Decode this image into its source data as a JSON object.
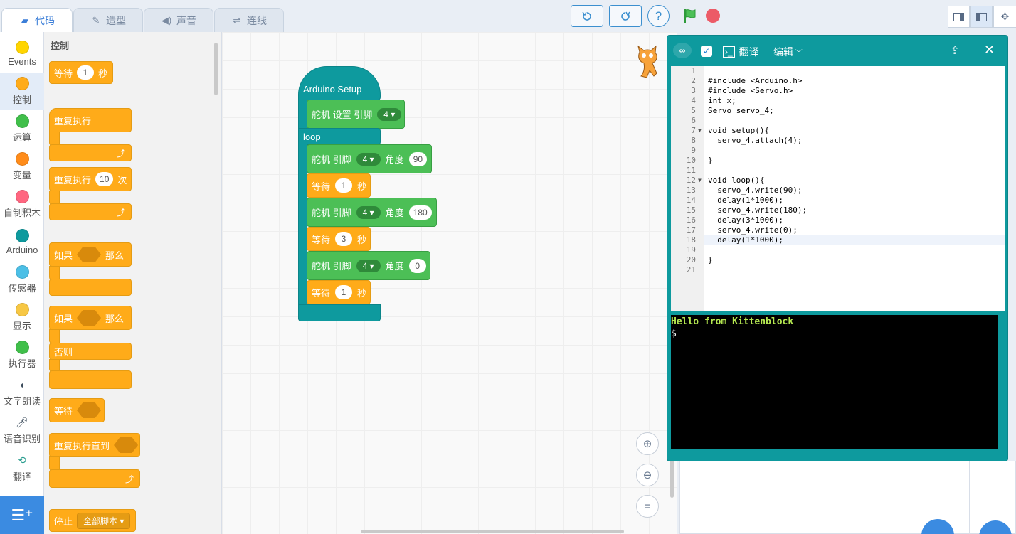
{
  "tabs": [
    {
      "label": "代码",
      "icon": "code-blocks-icon"
    },
    {
      "label": "造型",
      "icon": "brush-icon"
    },
    {
      "label": "声音",
      "icon": "speaker-icon"
    },
    {
      "label": "连线",
      "icon": "wiring-icon"
    }
  ],
  "toolbar": {
    "undo_icon": "undo-icon",
    "redo_icon": "redo-icon",
    "help_label": "?"
  },
  "categories": [
    {
      "label": "Events",
      "color": "#ffd500"
    },
    {
      "label": "控制",
      "color": "#ffab19"
    },
    {
      "label": "运算",
      "color": "#40bf4a"
    },
    {
      "label": "变量",
      "color": "#ff8c1a"
    },
    {
      "label": "自制积木",
      "color": "#ff6680"
    },
    {
      "label": "Arduino",
      "color": "#0e9a9e"
    },
    {
      "label": "传感器",
      "color": "#4cbfe6"
    },
    {
      "label": "显示",
      "color": "#f7c744"
    },
    {
      "label": "执行器",
      "color": "#40bf4a"
    },
    {
      "label": "文字朗读",
      "icon": "speech-icon"
    },
    {
      "label": "语音识别",
      "icon": "microphone-icon"
    },
    {
      "label": "翻译",
      "icon": "translate-icon"
    }
  ],
  "palette": {
    "title": "控制",
    "wait_label": "等待",
    "wait_value": "1",
    "seconds": "秒",
    "forever_label": "重复执行",
    "repeat_label": "重复执行",
    "repeat_value": "10",
    "times": "次",
    "if_label": "如果",
    "then_label": "那么",
    "else_label": "否则",
    "wait_until_label": "等待",
    "repeat_until_label": "重复执行直到",
    "stop_label": "停止",
    "stop_option": "全部脚本"
  },
  "script": {
    "setup_label": "Arduino Setup",
    "loop_label": "loop",
    "servo_setup_label": "舵机 设置 引脚",
    "servo_label": "舵机 引脚",
    "angle_label": "角度",
    "pin": "4",
    "wait_label": "等待",
    "seconds": "秒",
    "angles": [
      "90",
      "180",
      "0"
    ],
    "waits": [
      "1",
      "3",
      "1"
    ]
  },
  "arduino_panel": {
    "translate_label": "翻译",
    "edit_label": "编辑",
    "logo": "∞",
    "code_lines": [
      "",
      "#include <Arduino.h>",
      "#include <Servo.h>",
      "int x;",
      "Servo servo_4;",
      "",
      "void setup(){",
      "  servo_4.attach(4);",
      "",
      "}",
      "",
      "void loop(){",
      "  servo_4.write(90);",
      "  delay(1*1000);",
      "  servo_4.write(180);",
      "  delay(3*1000);",
      "  servo_4.write(0);",
      "  delay(1*1000);",
      "",
      "}",
      ""
    ],
    "highlighted_line": 18,
    "terminal_lines": [
      "Hello from Kittenblock",
      "$"
    ]
  }
}
